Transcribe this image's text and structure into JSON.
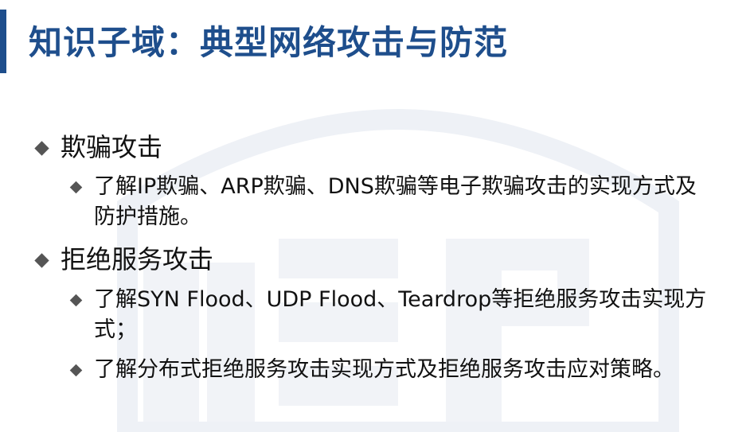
{
  "slide": {
    "title": "知识子域：典型网络攻击与防范",
    "accent_color": "#1e4e8c",
    "bullet_icon": "diamond-bullet-icon",
    "watermark_icon": "shield-logo-watermark-icon",
    "sections": [
      {
        "heading": "欺骗攻击",
        "items": [
          "了解IP欺骗、ARP欺骗、DNS欺骗等电子欺骗攻击的实现方式及防护措施。"
        ]
      },
      {
        "heading": "拒绝服务攻击",
        "items": [
          "了解SYN Flood、UDP Flood、Teardrop等拒绝服务攻击实现方式；",
          "了解分布式拒绝服务攻击实现方式及拒绝服务攻击应对策略。"
        ]
      }
    ]
  }
}
